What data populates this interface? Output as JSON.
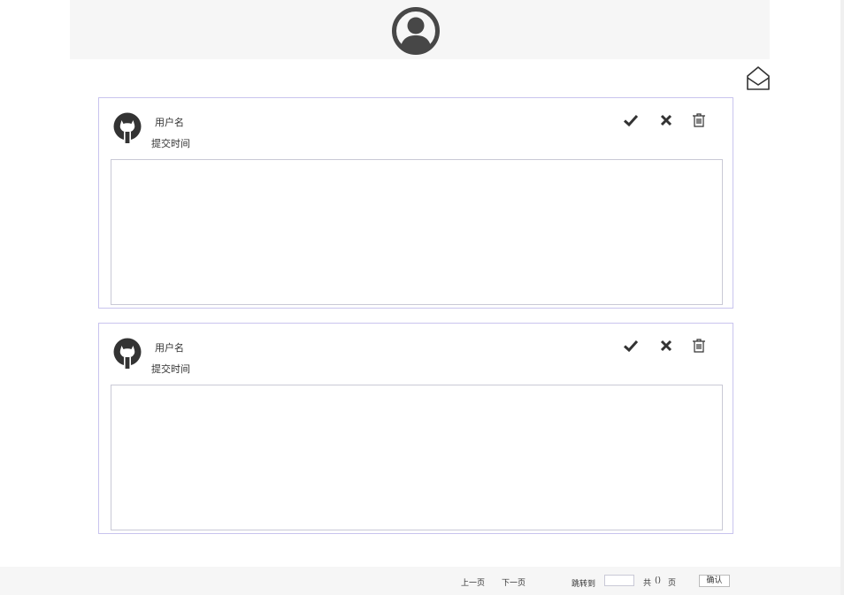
{
  "header": {
    "avatar_icon": "user-circle-icon"
  },
  "mail_icon": "envelope-open-icon",
  "cards": [
    {
      "username": "用户名",
      "time_label": "提交时间",
      "avatar_icon": "github-icon",
      "content": ""
    },
    {
      "username": "用户名",
      "time_label": "提交时间",
      "avatar_icon": "github-icon",
      "content": ""
    }
  ],
  "actions": {
    "approve_icon": "check-icon",
    "reject_icon": "close-icon",
    "delete_icon": "trash-icon"
  },
  "pagination": {
    "prev_label": "上一页",
    "next_label": "下一页",
    "jump_label": "跳转到",
    "page_input_value": "",
    "total_prefix": "共",
    "total_value": "()",
    "total_suffix": "页",
    "confirm_label": "确认"
  },
  "colors": {
    "card_border": "#c9c4ee",
    "header_bg": "#f6f6f6",
    "icon": "#333333"
  }
}
